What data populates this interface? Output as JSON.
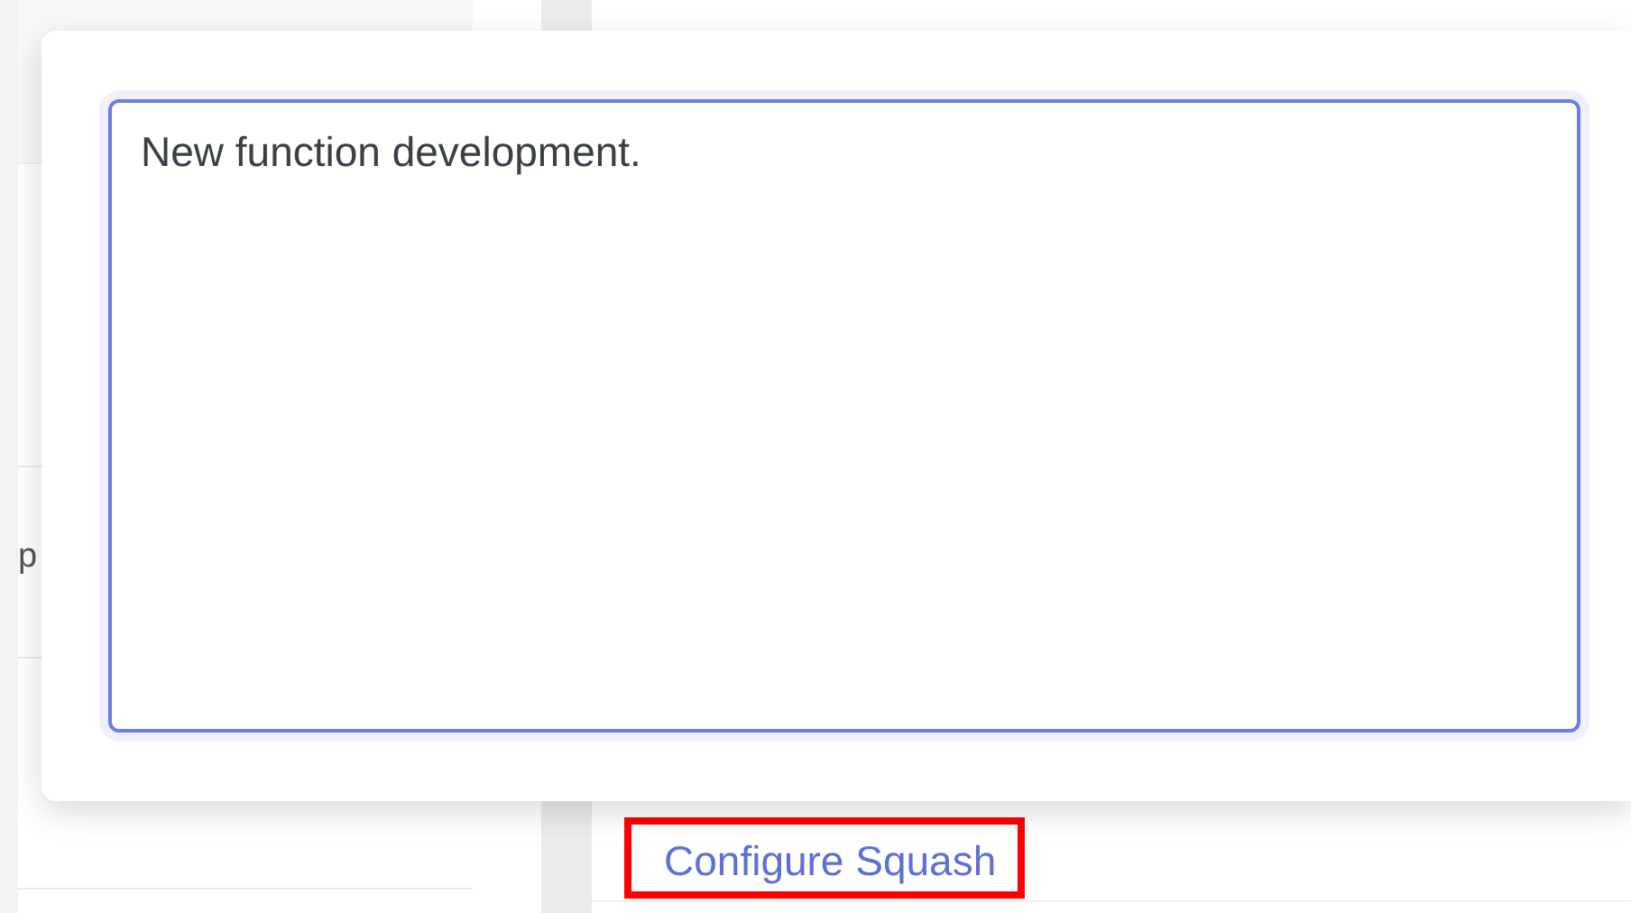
{
  "background": {
    "left_panel": {
      "partial_text": "p"
    },
    "squash_link": {
      "label": "Configure Squash",
      "highlighted": true
    }
  },
  "dialog": {
    "textarea": {
      "value": "New function development.",
      "focused": true
    }
  }
}
